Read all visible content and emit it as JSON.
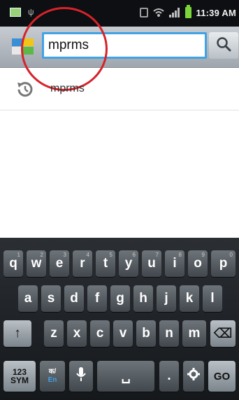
{
  "status_bar": {
    "time": "11:39 AM"
  },
  "search": {
    "value": "mprms",
    "icon": "search-icon"
  },
  "suggestions": [
    {
      "label": "mprms",
      "icon": "history-icon"
    }
  ],
  "keyboard": {
    "row1": [
      {
        "label": "q",
        "sub": "1"
      },
      {
        "label": "w",
        "sub": "2"
      },
      {
        "label": "e",
        "sub": "3"
      },
      {
        "label": "r",
        "sub": "4"
      },
      {
        "label": "t",
        "sub": "5"
      },
      {
        "label": "y",
        "sub": "6"
      },
      {
        "label": "u",
        "sub": "7"
      },
      {
        "label": "i",
        "sub": "8"
      },
      {
        "label": "o",
        "sub": "9"
      },
      {
        "label": "p",
        "sub": "0"
      }
    ],
    "row2": [
      "a",
      "s",
      "d",
      "f",
      "g",
      "h",
      "j",
      "k",
      "l"
    ],
    "row3": [
      "z",
      "x",
      "c",
      "v",
      "b",
      "n",
      "m"
    ],
    "shift_label": "↑",
    "backspace_label": "⌫",
    "sym_label_top": "123",
    "sym_label_bottom": "SYM",
    "lang_label_top": "क/",
    "lang_label_bottom": "En",
    "space_label": "␣",
    "period_label": ".",
    "go_label": "GO",
    "accent_color": "#3fa3e6",
    "annotation_color": "#d6232a"
  }
}
